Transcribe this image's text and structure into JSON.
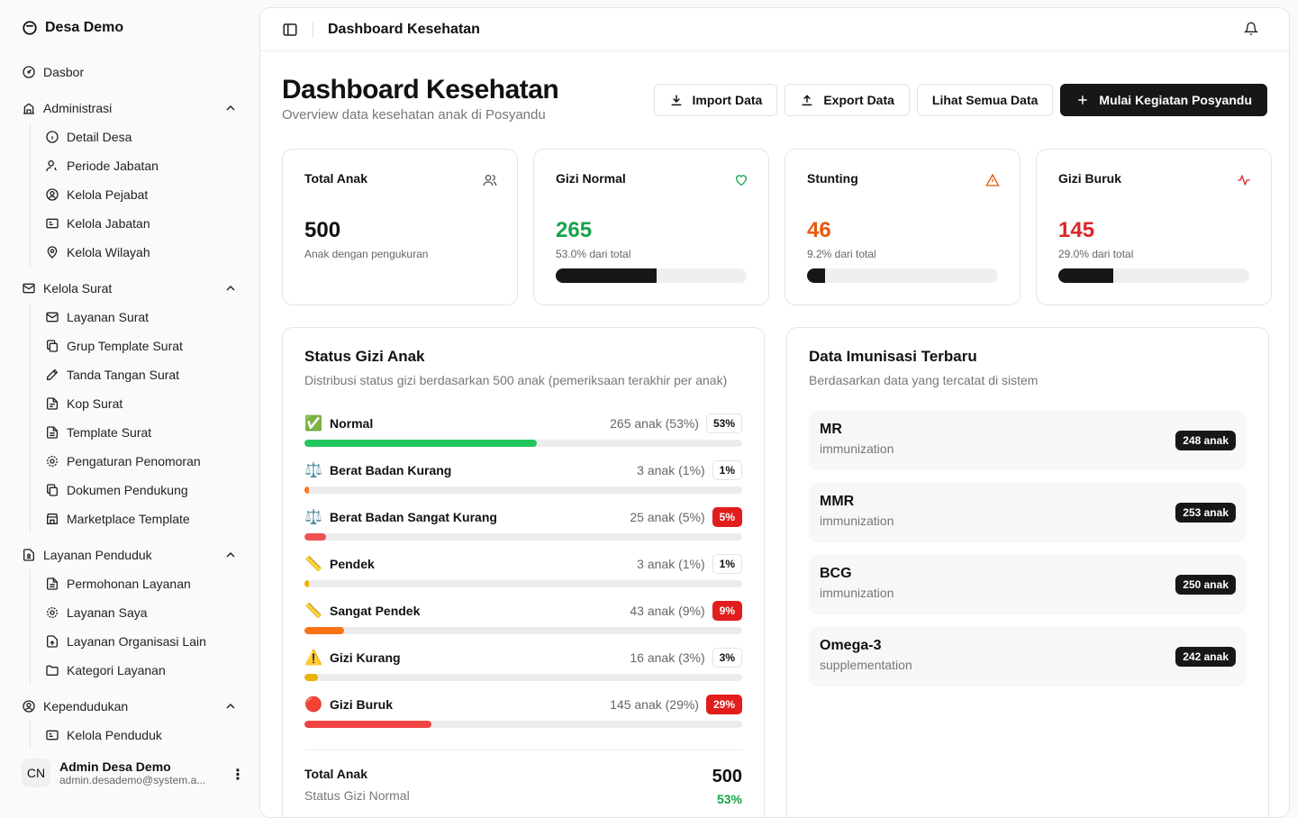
{
  "sidebar": {
    "brand": "Desa Demo",
    "dasbor": "Dasbor",
    "administrasi": {
      "label": "Administrasi",
      "items": [
        "Detail Desa",
        "Periode Jabatan",
        "Kelola Pejabat",
        "Kelola Jabatan",
        "Kelola Wilayah"
      ]
    },
    "kelola_surat": {
      "label": "Kelola Surat",
      "items": [
        "Layanan Surat",
        "Grup Template Surat",
        "Tanda Tangan Surat",
        "Kop Surat",
        "Template Surat",
        "Pengaturan Penomoran",
        "Dokumen Pendukung",
        "Marketplace Template"
      ]
    },
    "layanan_penduduk": {
      "label": "Layanan Penduduk",
      "items": [
        "Permohonan Layanan",
        "Layanan Saya",
        "Layanan Organisasi Lain",
        "Kategori Layanan"
      ]
    },
    "kependudukan": {
      "label": "Kependudukan",
      "items": [
        "Kelola Penduduk"
      ]
    },
    "user": {
      "initials": "CN",
      "name": "Admin Desa Demo",
      "email": "admin.desademo@system.a..."
    }
  },
  "topbar": {
    "title": "Dashboard Kesehatan"
  },
  "header": {
    "title": "Dashboard Kesehatan",
    "subtitle": "Overview data kesehatan anak di Posyandu"
  },
  "actions": {
    "import": "Import Data",
    "export": "Export Data",
    "lihat": "Lihat Semua Data",
    "mulai": "Mulai Kegiatan Posyandu"
  },
  "stats": [
    {
      "label": "Total Anak",
      "value": "500",
      "sub": "Anak dengan pengukuran",
      "color": "#111111",
      "icon": "users-icon"
    },
    {
      "label": "Gizi Normal",
      "value": "265",
      "sub": "53.0% dari total",
      "color": "#16a34a",
      "icon": "heart-icon",
      "progress": 53.0
    },
    {
      "label": "Stunting",
      "value": "46",
      "sub": "9.2% dari total",
      "color": "#ea580c",
      "icon": "warning-icon",
      "progress": 9.2
    },
    {
      "label": "Gizi Buruk",
      "value": "145",
      "sub": "29.0% dari total",
      "color": "#dc2626",
      "icon": "activity-icon",
      "progress": 29.0
    }
  ],
  "gizi": {
    "title": "Status Gizi Anak",
    "desc": "Distribusi status gizi berdasarkan 500 anak (pemeriksaan terakhir per anak)",
    "rows": [
      {
        "emoji": "✅",
        "label": "Normal",
        "count": "265 anak (53%)",
        "badge": "53%",
        "pct": 53,
        "color": "#22c55e",
        "red": false
      },
      {
        "emoji": "⚖️",
        "label": "Berat Badan Kurang",
        "count": "3 anak (1%)",
        "badge": "1%",
        "pct": 1,
        "color": "#f97316",
        "red": false
      },
      {
        "emoji": "⚖️",
        "label": "Berat Badan Sangat Kurang",
        "count": "25 anak (5%)",
        "badge": "5%",
        "pct": 5,
        "color": "#f05252",
        "red": true
      },
      {
        "emoji": "📏",
        "label": "Pendek",
        "count": "3 anak (1%)",
        "badge": "1%",
        "pct": 1,
        "color": "#eab308",
        "red": false
      },
      {
        "emoji": "📏",
        "label": "Sangat Pendek",
        "count": "43 anak (9%)",
        "badge": "9%",
        "pct": 9,
        "color": "#f97316",
        "red": true
      },
      {
        "emoji": "⚠️",
        "label": "Gizi Kurang",
        "count": "16 anak (3%)",
        "badge": "3%",
        "pct": 3,
        "color": "#eab308",
        "red": false
      },
      {
        "emoji": "🔴",
        "label": "Gizi Buruk",
        "count": "145 anak (29%)",
        "badge": "29%",
        "pct": 29,
        "color": "#ef4444",
        "red": true
      }
    ],
    "total_label": "Total Anak",
    "total_value": "500",
    "normal_label": "Status Gizi Normal",
    "normal_value": "53%"
  },
  "imunisasi": {
    "title": "Data Imunisasi Terbaru",
    "desc": "Berdasarkan data yang tercatat di sistem",
    "rows": [
      {
        "name": "MR",
        "type": "immunization",
        "count": "248 anak"
      },
      {
        "name": "MMR",
        "type": "immunization",
        "count": "253 anak"
      },
      {
        "name": "BCG",
        "type": "immunization",
        "count": "250 anak"
      },
      {
        "name": "Omega-3",
        "type": "supplementation",
        "count": "242 anak"
      }
    ]
  }
}
